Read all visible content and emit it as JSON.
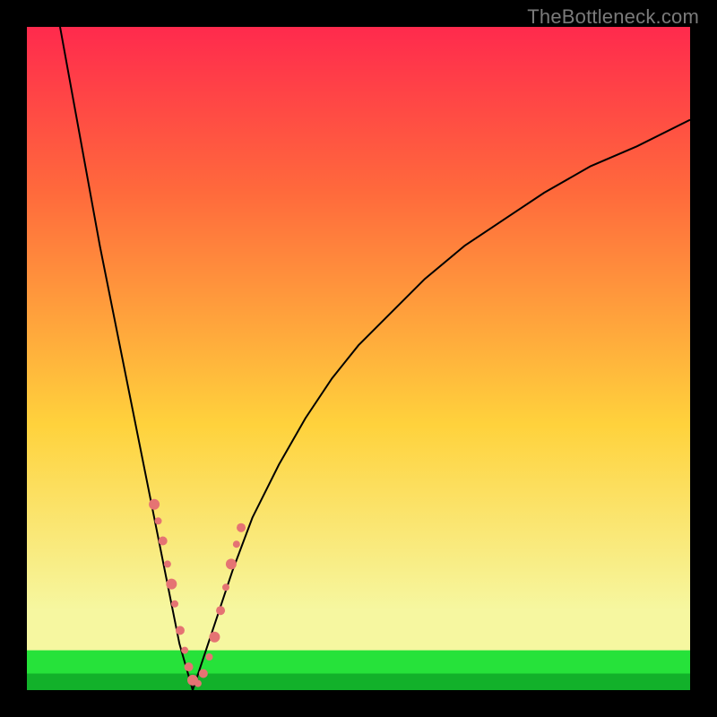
{
  "watermark": {
    "text": "TheBottleneck.com"
  },
  "chart_data": {
    "type": "line",
    "title": "",
    "xlabel": "",
    "ylabel": "",
    "xlim": [
      0,
      100
    ],
    "ylim": [
      0,
      100
    ],
    "grid": false,
    "legend": false,
    "series": [
      {
        "name": "left-branch",
        "x": [
          5,
          7,
          9,
          11,
          13,
          15,
          17,
          18,
          19,
          20,
          21,
          22,
          23,
          24,
          25
        ],
        "y": [
          100,
          89,
          78,
          67,
          57,
          47,
          37,
          32,
          27,
          22,
          17,
          12,
          7,
          3.5,
          0
        ],
        "color": "#000000"
      },
      {
        "name": "right-branch",
        "x": [
          25,
          27,
          29,
          31,
          34,
          38,
          42,
          46,
          50,
          55,
          60,
          66,
          72,
          78,
          85,
          92,
          100
        ],
        "y": [
          0,
          6,
          12,
          18,
          26,
          34,
          41,
          47,
          52,
          57,
          62,
          67,
          71,
          75,
          79,
          82,
          86
        ],
        "color": "#000000"
      },
      {
        "name": "green-band-top",
        "x": [
          0,
          100
        ],
        "y": [
          6,
          6
        ],
        "color": "#26e23a"
      },
      {
        "name": "green-band-bottom",
        "x": [
          0,
          100
        ],
        "y": [
          0,
          0
        ],
        "color": "#26e23a"
      },
      {
        "name": "cream-band-top",
        "x": [
          0,
          100
        ],
        "y": [
          12,
          12
        ],
        "color": "#f6f7a0"
      }
    ],
    "markers": [
      {
        "x": 19.2,
        "y": 28.0,
        "r": 6,
        "color": "#e57373"
      },
      {
        "x": 19.8,
        "y": 25.5,
        "r": 4,
        "color": "#e57373"
      },
      {
        "x": 20.5,
        "y": 22.5,
        "r": 5,
        "color": "#e57373"
      },
      {
        "x": 21.2,
        "y": 19.0,
        "r": 4,
        "color": "#e57373"
      },
      {
        "x": 21.8,
        "y": 16.0,
        "r": 6,
        "color": "#e57373"
      },
      {
        "x": 22.3,
        "y": 13.0,
        "r": 4,
        "color": "#e57373"
      },
      {
        "x": 23.1,
        "y": 9.0,
        "r": 5,
        "color": "#e57373"
      },
      {
        "x": 23.8,
        "y": 6.0,
        "r": 4,
        "color": "#e57373"
      },
      {
        "x": 24.4,
        "y": 3.5,
        "r": 5,
        "color": "#e57373"
      },
      {
        "x": 25.0,
        "y": 1.5,
        "r": 6,
        "color": "#e57373"
      },
      {
        "x": 25.8,
        "y": 1.0,
        "r": 4,
        "color": "#e57373"
      },
      {
        "x": 26.6,
        "y": 2.5,
        "r": 5,
        "color": "#e57373"
      },
      {
        "x": 27.5,
        "y": 5.0,
        "r": 4,
        "color": "#e57373"
      },
      {
        "x": 28.3,
        "y": 8.0,
        "r": 6,
        "color": "#e57373"
      },
      {
        "x": 29.2,
        "y": 12.0,
        "r": 5,
        "color": "#e57373"
      },
      {
        "x": 30.0,
        "y": 15.5,
        "r": 4,
        "color": "#e57373"
      },
      {
        "x": 30.8,
        "y": 19.0,
        "r": 6,
        "color": "#e57373"
      },
      {
        "x": 31.6,
        "y": 22.0,
        "r": 4,
        "color": "#e57373"
      },
      {
        "x": 32.3,
        "y": 24.5,
        "r": 5,
        "color": "#e57373"
      }
    ],
    "background_gradient": {
      "top": "#ff2a4d",
      "mid": "#ffd23c",
      "bottom": "#26e23a"
    }
  }
}
